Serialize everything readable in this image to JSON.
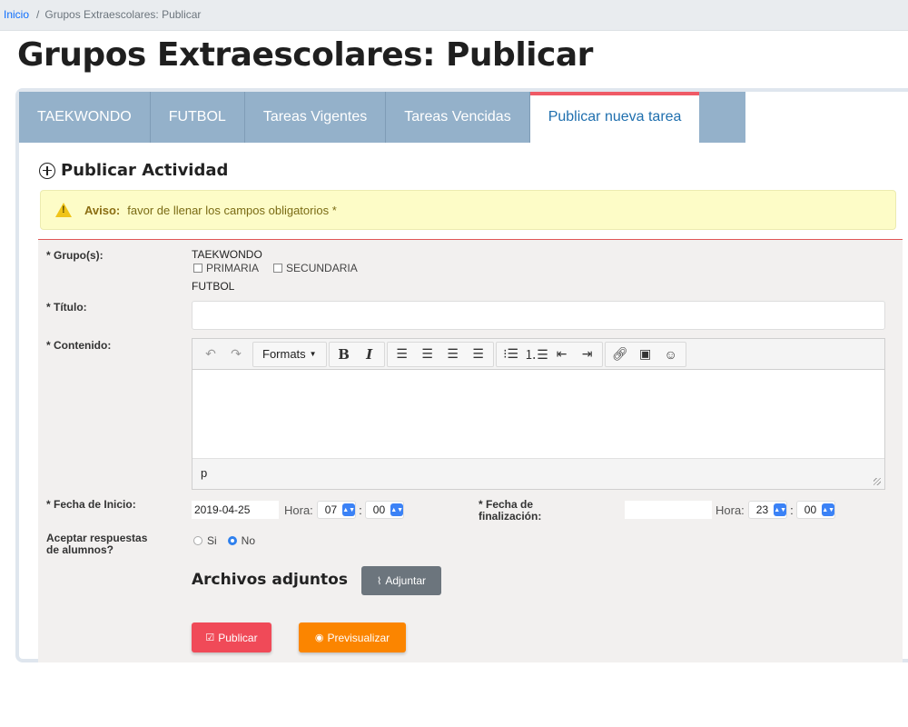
{
  "breadcrumb": {
    "home": "Inicio",
    "separator": "/",
    "current": "Grupos Extraescolares: Publicar"
  },
  "page": {
    "title": "Grupos Extraescolares: Publicar"
  },
  "tabs": [
    {
      "label": "TAEKWONDO"
    },
    {
      "label": "FUTBOL"
    },
    {
      "label": "Tareas Vigentes"
    },
    {
      "label": "Tareas Vencidas"
    },
    {
      "label": "Publicar nueva tarea"
    }
  ],
  "section": {
    "heading": "Publicar Actividad"
  },
  "alert": {
    "strong": "Aviso:",
    "message": "favor de llenar los campos obligatorios *"
  },
  "form": {
    "grupos_label": "* Grupo(s):",
    "group1": "TAEKWONDO",
    "check_primaria": "PRIMARIA",
    "check_secundaria": "SECUNDARIA",
    "group2": "FUTBOL",
    "titulo_label": "* Título:",
    "titulo_value": "",
    "contenido_label": "* Contenido:",
    "editor": {
      "formats": "Formats",
      "bold": "B",
      "italic": "I",
      "status_path": "p"
    },
    "fecha_inicio_label": "* Fecha de Inicio:",
    "fecha_inicio_value": "2019-04-25",
    "hora_label": "Hora:",
    "hora_inicio_h": "07",
    "hora_inicio_m": "00",
    "fecha_fin_label_1": "* Fecha de",
    "fecha_fin_label_2": "finalización:",
    "fecha_fin_value": "",
    "hora_fin_h": "23",
    "hora_fin_m": "00",
    "colon": ":",
    "aceptar_label_1": "Aceptar respuestas",
    "aceptar_label_2": "de alumnos?",
    "radio_si": "Si",
    "radio_no": "No",
    "archivos_title": "Archivos adjuntos",
    "adjuntar_button": "Adjuntar",
    "publicar_button": "Publicar",
    "previsualizar_button": "Previsualizar"
  },
  "colors": {
    "tab_bg": "#94b1ca",
    "active_tab_accent": "#ef5a66",
    "publish": "#f04a58",
    "preview": "#fb8500",
    "attach": "#6c757d"
  }
}
